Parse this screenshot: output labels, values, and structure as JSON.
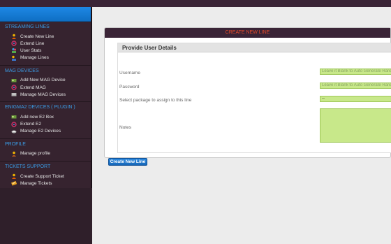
{
  "sidebar": {
    "sections": [
      {
        "title": "STREAMING LINES",
        "items": [
          {
            "label": "Create New Line",
            "icon": "user-add-icon"
          },
          {
            "label": "Extend Line",
            "icon": "refresh-icon"
          },
          {
            "label": "User Stats",
            "icon": "users-stats-icon"
          },
          {
            "label": "Manage Lines",
            "icon": "users-manage-icon"
          }
        ]
      },
      {
        "title": "MAG DEVICES",
        "items": [
          {
            "label": "Add New MAG Device",
            "icon": "device-add-icon"
          },
          {
            "label": "Extend MAG",
            "icon": "refresh-icon"
          },
          {
            "label": "Manage MAG Devices",
            "icon": "device-list-icon"
          }
        ]
      },
      {
        "title": "ENIGMA2 DEVICES ( PLUGIN )",
        "items": [
          {
            "label": "Add new E2 Box",
            "icon": "device-add-icon"
          },
          {
            "label": "Extend E2",
            "icon": "refresh-icon"
          },
          {
            "label": "Manage E2 Devices",
            "icon": "device-list-icon"
          }
        ]
      },
      {
        "title": "PROFILE",
        "items": [
          {
            "label": "Manage profile",
            "icon": "user-icon"
          }
        ]
      },
      {
        "title": "TICKETS SUPPORT",
        "items": [
          {
            "label": "Create Support Ticket",
            "icon": "ticket-add-icon"
          },
          {
            "label": "Manage Tickets",
            "icon": "ticket-icon"
          }
        ]
      }
    ]
  },
  "main": {
    "panel_title": "CREATE NEW LINE",
    "form_title": "Provide User Details",
    "fields": {
      "username_label": "Username",
      "username_placeholder": "Leave it Blank to Auto Generate Random",
      "password_label": "Password",
      "password_placeholder": "Leave it Blank to Auto Generate Random",
      "package_label": "Select package to assign to this line",
      "package_value": "--",
      "notes_label": "Notes"
    },
    "submit_label": "Create New Line"
  },
  "colors": {
    "sidebar_bg": "#36232f",
    "section_title": "#3a9be5",
    "panel_title": "#e64b2a",
    "input_bg": "#c8e88a",
    "button_bg": "#1e78cc"
  }
}
